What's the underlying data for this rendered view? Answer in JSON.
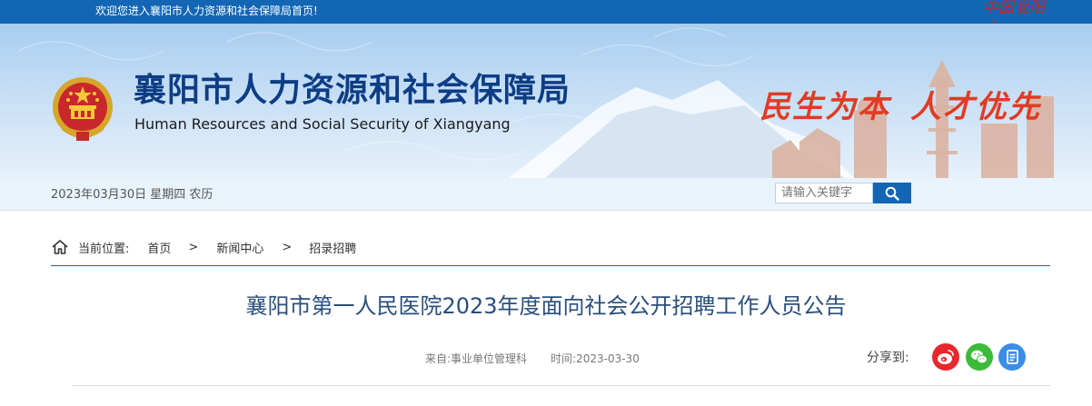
{
  "topbar": {
    "welcome": "欢迎您进入襄阳市人力资源和社会保障局首页!",
    "seal_text": "中国襄阳"
  },
  "header": {
    "title": "襄阳市人力资源和社会保障局",
    "subtitle": "Human Resources and Social Security of Xiangyang",
    "slogan_left": "民生为本",
    "slogan_right": "人才优先",
    "emblem_icon": "national-emblem-icon"
  },
  "strip": {
    "date": "2023年03月30日 星期四 农历",
    "search_placeholder": "请输入关键字",
    "search_icon": "search-icon"
  },
  "breadcrumb": {
    "label": "当前位置:",
    "items": [
      "首页",
      "新闻中心",
      "招录招聘"
    ],
    "separator": ">"
  },
  "article": {
    "title": "襄阳市第一人民医院2023年度面向社会公开招聘工作人员公告",
    "source": "来自:事业单位管理科",
    "time": "时间:2023-03-30",
    "share_label": "分享到:"
  },
  "colors": {
    "brand_blue": "#1366b4",
    "title_blue": "#0d3d84",
    "slogan_red": "#e13b24",
    "weibo": "#e6282c",
    "wechat": "#3dba3a",
    "other": "#3a8ee6"
  }
}
